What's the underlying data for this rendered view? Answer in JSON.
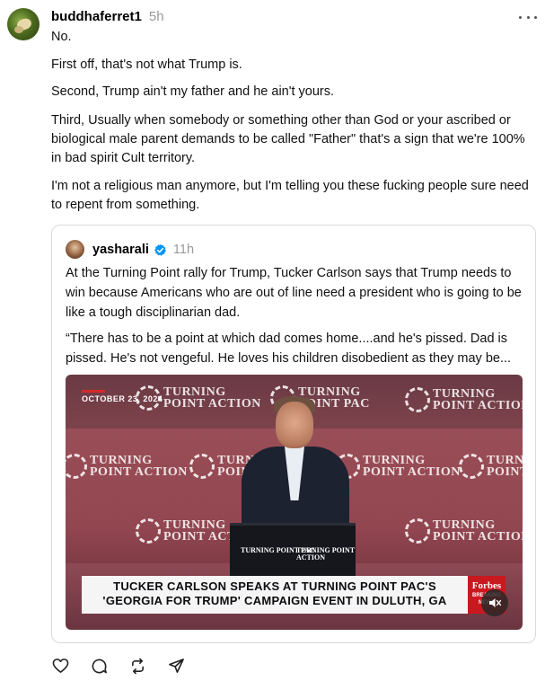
{
  "post": {
    "username": "buddhaferret1",
    "timestamp": "5h",
    "paragraphs": [
      "No.",
      "First off, that's not what Trump is.",
      "Second, Trump ain't my father and he ain't yours.",
      "Third, Usually when somebody or something other than God or your ascribed or biological male parent demands to be called \"Father\" that's a sign that we're 100% in bad spirit Cult territory.",
      "I'm not a religious man anymore, but I'm telling you these fucking people sure need to repent from something."
    ],
    "more_icon": "more-horizontal-icon"
  },
  "quote": {
    "username": "yasharali",
    "verified_icon": "verified-badge-icon",
    "timestamp": "11h",
    "paragraphs": [
      "At the Turning Point rally for Trump, Tucker Carlson says that Trump needs to win because Americans who are out of line need a president who is going to be like a tough disciplinarian dad.",
      "“There has to be a point at which dad comes home....and he's pissed. Dad is pissed. He's not vengeful. He loves his children disobedient as they may be..."
    ],
    "video": {
      "date_overlay": "OCTOBER 23, 2024",
      "backdrop_logo_line1": "TURNING",
      "backdrop_logo_line2": "POINT ACTION",
      "backdrop_logo_alt_line2": "POINT PAC",
      "podium_logo_left": "TURNING POINT PAC",
      "podium_logo_right": "TURNING POINT ACTION",
      "lower_third_line1": "TUCKER CARLSON SPEAKS AT TURNING POINT PAC'S",
      "lower_third_line2": "'GEORGIA FOR TRUMP' CAMPAIGN EVENT IN DULUTH, GA",
      "forbes_brand": "Forbes",
      "forbes_sub": "BREAKING NEWS",
      "mute_icon": "muted-speaker-icon"
    }
  },
  "actions": [
    {
      "name": "like",
      "icon": "heart-icon"
    },
    {
      "name": "reply",
      "icon": "comment-icon"
    },
    {
      "name": "repost",
      "icon": "repost-icon"
    },
    {
      "name": "share",
      "icon": "send-icon"
    }
  ],
  "colors": {
    "text": "#111111",
    "muted": "#999999",
    "border": "#d9d9d9",
    "verified": "#0095f6",
    "forbes_red": "#c8191f"
  }
}
